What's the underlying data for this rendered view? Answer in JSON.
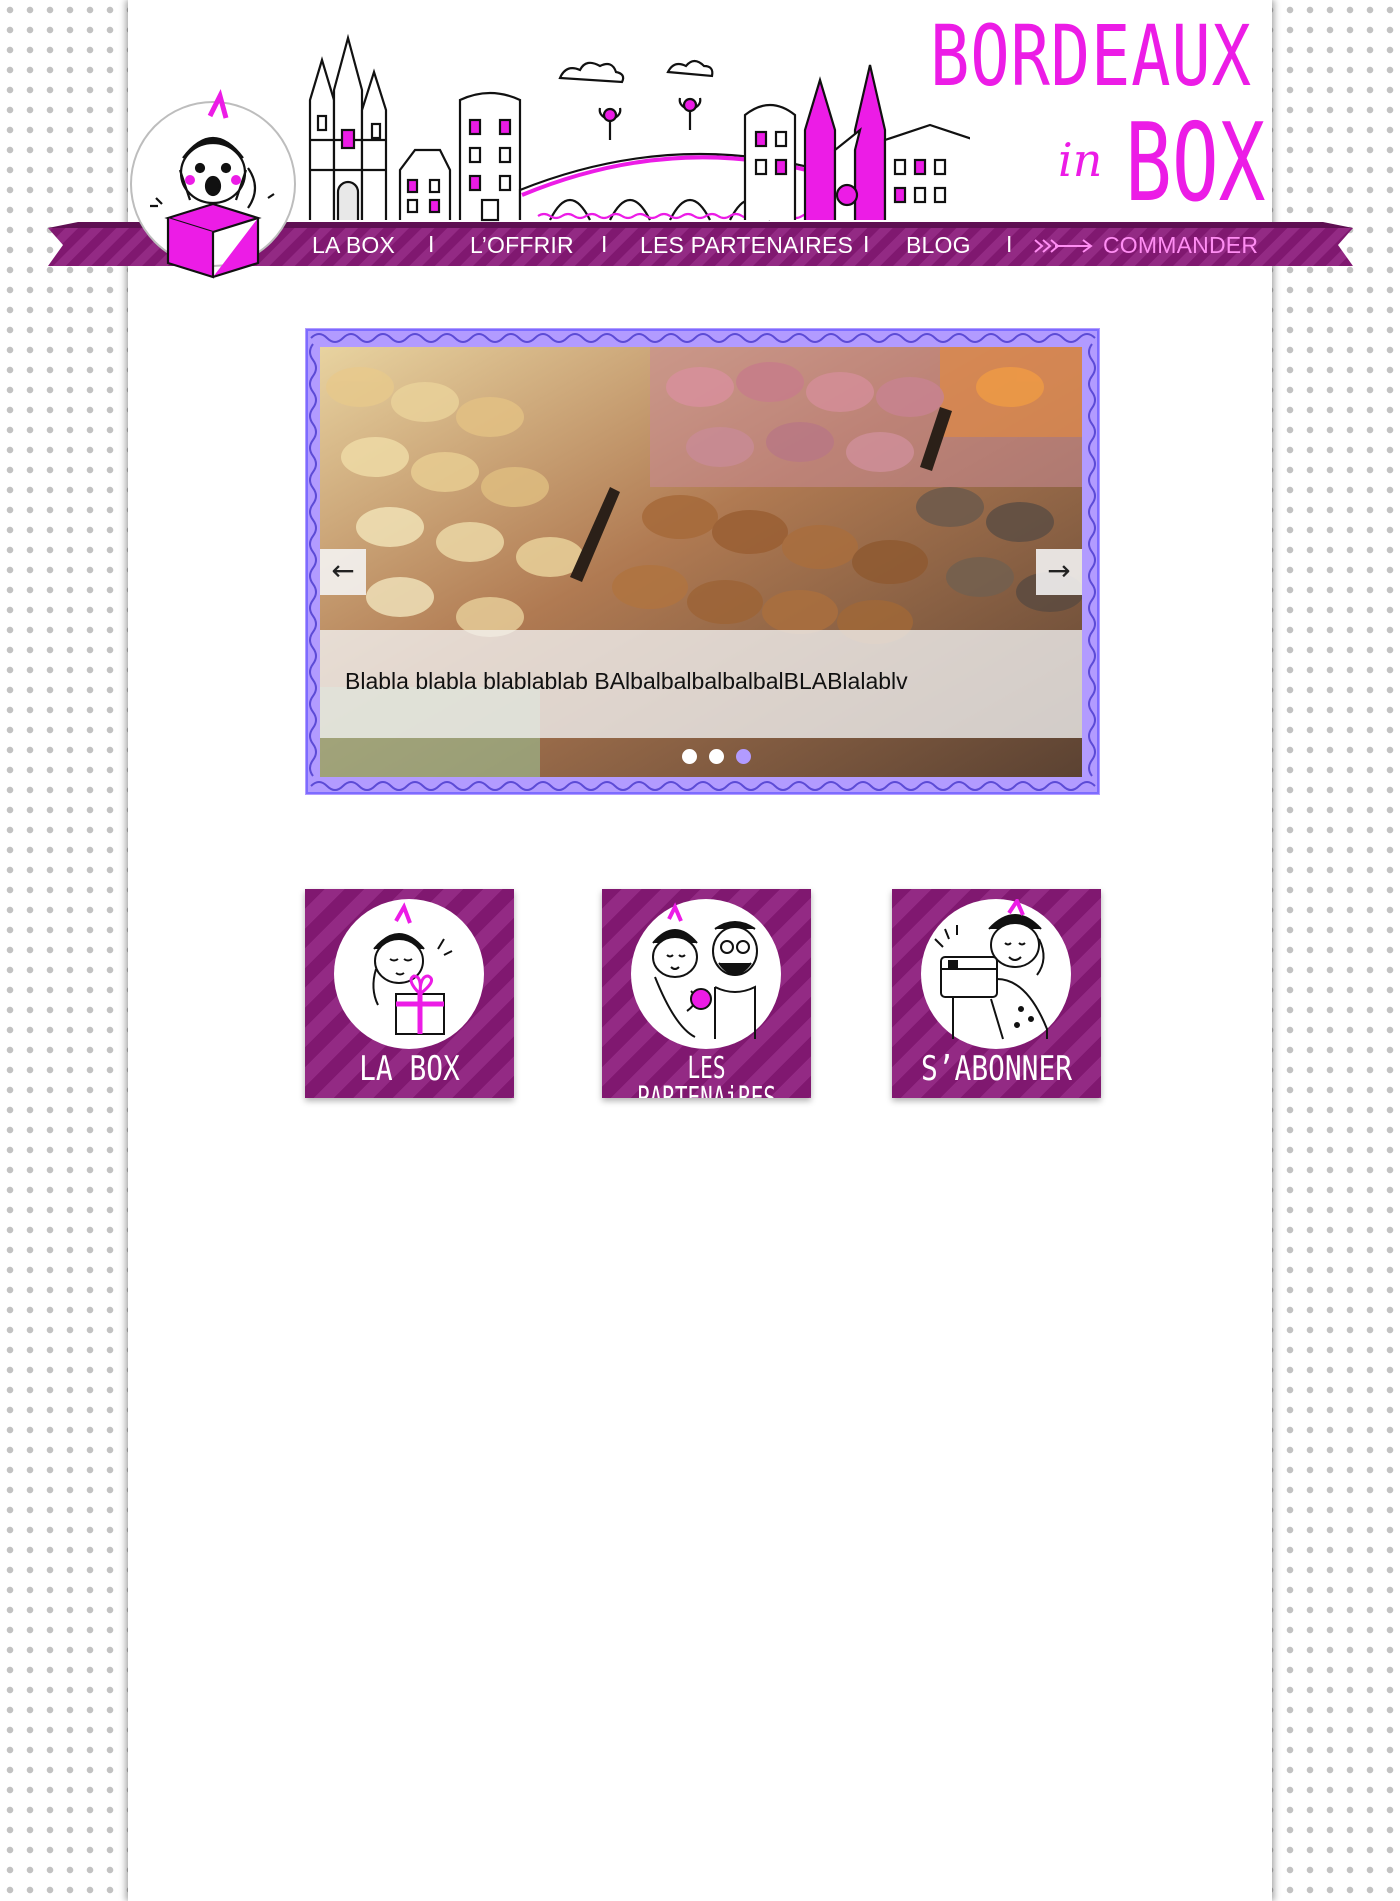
{
  "brand": {
    "line1": "BORDEAUX",
    "line2": "in",
    "line3": "BOX",
    "color": "#ec1ce6"
  },
  "nav": {
    "items": [
      {
        "label": "LA BOX"
      },
      {
        "label": "L’OFFRIR"
      },
      {
        "label": "LES PARTENAIRES"
      },
      {
        "label": "BLOG"
      }
    ],
    "separator": "I",
    "order_label": "COMMANDER",
    "ribbon_color": "#801870",
    "order_color": "#ff8df3"
  },
  "slider": {
    "caption": "Blabla blabla blablablab BAlbalbalbalbalbalBLABlalablv",
    "prev_icon": "arrow-left-icon",
    "next_icon": "arrow-right-icon",
    "prev_glyph": "←",
    "next_glyph": "→",
    "slide_count": 3,
    "active_index": 2,
    "frame_color": "#b29bff"
  },
  "tiles": [
    {
      "label": "LA BOX"
    },
    {
      "label": "LES PARTENAiRES"
    },
    {
      "label": "S’ABONNER"
    }
  ]
}
